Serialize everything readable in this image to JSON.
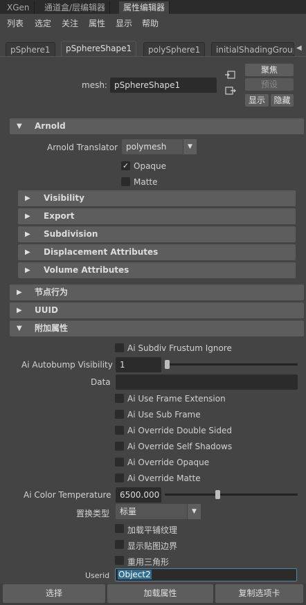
{
  "panel_tabs": [
    "XGen",
    "通道盒/层编辑器",
    "属性编辑器"
  ],
  "menu": [
    "列表",
    "选定",
    "关注",
    "属性",
    "显示",
    "帮助"
  ],
  "node_tabs": [
    "pSphere1",
    "pSphereShape1",
    "polySphere1",
    "initialShadingGroup"
  ],
  "mesh": {
    "label": "mesh:",
    "value": "pSphereShape1"
  },
  "side_buttons": {
    "focus": "聚焦",
    "preset": "预设",
    "show": "显示",
    "hide": "隐藏"
  },
  "arnold": {
    "title": "Arnold",
    "translator_label": "Arnold Translator",
    "translator_value": "polymesh",
    "opaque": {
      "label": "Opaque",
      "checked": true
    },
    "matte": {
      "label": "Matte",
      "checked": false
    },
    "subsections": [
      "Visibility",
      "Export",
      "Subdivision",
      "Displacement Attributes",
      "Volume Attributes"
    ]
  },
  "sections": [
    "节点行为",
    "UUID",
    "附加属性"
  ],
  "extra": {
    "subdiv_frustum": "Ai Subdiv Frustum Ignore",
    "autobump_label": "Ai Autobump Visibility",
    "autobump_value": "1",
    "data_label": "Data",
    "data_value": "",
    "checks": [
      "Ai Use Frame Extension",
      "Ai Use Sub Frame",
      "Ai Override Double Sided",
      "Ai Override Self Shadows",
      "Ai Override Opaque",
      "Ai Override Matte"
    ],
    "color_temp_label": "Ai Color Temperature",
    "color_temp_value": "6500.000",
    "displacement_type_label": "置换类型",
    "displacement_type_value": "标量",
    "cn_checks": [
      "加载平铺纹理",
      "显示贴图边界",
      "重用三角形"
    ],
    "userid_label": "Userid",
    "userid_value": "Object2"
  },
  "bottom_buttons": [
    "选择",
    "加载属性",
    "复制选项卡"
  ]
}
